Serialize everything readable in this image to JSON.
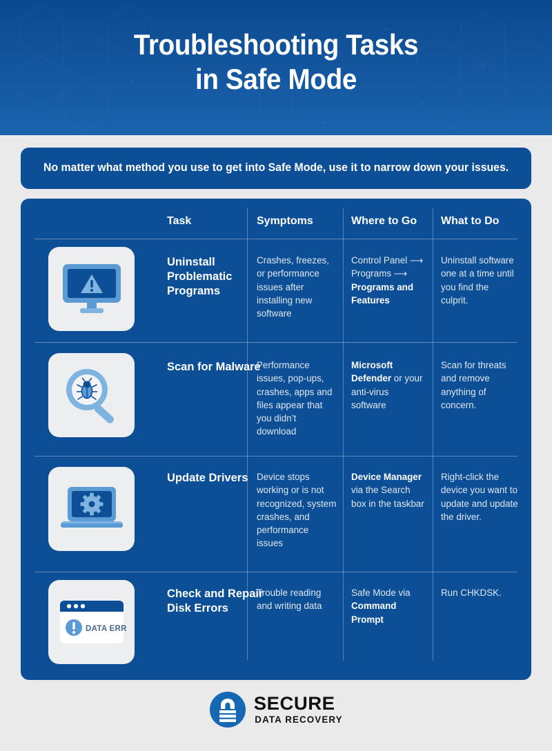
{
  "header": {
    "title_line1": "Troubleshooting Tasks",
    "title_line2": "in Safe Mode"
  },
  "banner": {
    "text": "No matter what method you use to get into Safe Mode, use it to narrow down your issues."
  },
  "table": {
    "columns": [
      {
        "label": "Task"
      },
      {
        "label": "Symptoms"
      },
      {
        "label": "Where to Go"
      },
      {
        "label": "What to Do"
      }
    ],
    "rows": [
      {
        "icon": "monitor-warning-icon",
        "task": "Uninstall Problematic Programs",
        "symptoms": "Crashes, freezes, or performance issues after installing new software",
        "where_plain_1": "Control Panel",
        "where_arrow_1": "⟶",
        "where_plain_2": "Programs",
        "where_arrow_2": "⟶",
        "where_bold": "Programs and Features",
        "what": "Uninstall software one at a time until you find the culprit."
      },
      {
        "icon": "magnifier-bug-icon",
        "task": "Scan for Malware",
        "symptoms": "Performance issues, pop-ups, crashes, apps and files appear that you didn’t download",
        "where_bold": "Microsoft Defender",
        "where_plain_after": " or your anti-virus software",
        "what": "Scan for threats and remove anything of concern."
      },
      {
        "icon": "laptop-gear-icon",
        "task": "Update Drivers",
        "symptoms": "Device stops working or is not recognized, system crashes, and performance issues",
        "where_bold": "Device Manager",
        "where_plain_after": " via the Search box in the taskbar",
        "what": "Right-click the device you want to update and update the driver."
      },
      {
        "icon": "data-error-window-icon",
        "task": "Check and Repair Disk Errors",
        "symptoms": "Trouble reading and writing data",
        "where_plain_before": "Safe Mode via ",
        "where_bold": "Command Prompt",
        "what": "Run CHKDSK."
      }
    ]
  },
  "icons": {
    "data_error_label": "DATA ERROR"
  },
  "footer": {
    "logo_main": "SECURE",
    "logo_sub": "DATA RECOVERY",
    "logo_icon": "padlock-circle-icon"
  },
  "colors": {
    "panel_blue": "#0d4f96",
    "page_bg": "#eaeaea",
    "header_top": "#0c4a8e",
    "header_bottom": "#1a63ad",
    "icon_light_blue": "#5b9bd5",
    "icon_card_bg": "#eceeef"
  }
}
